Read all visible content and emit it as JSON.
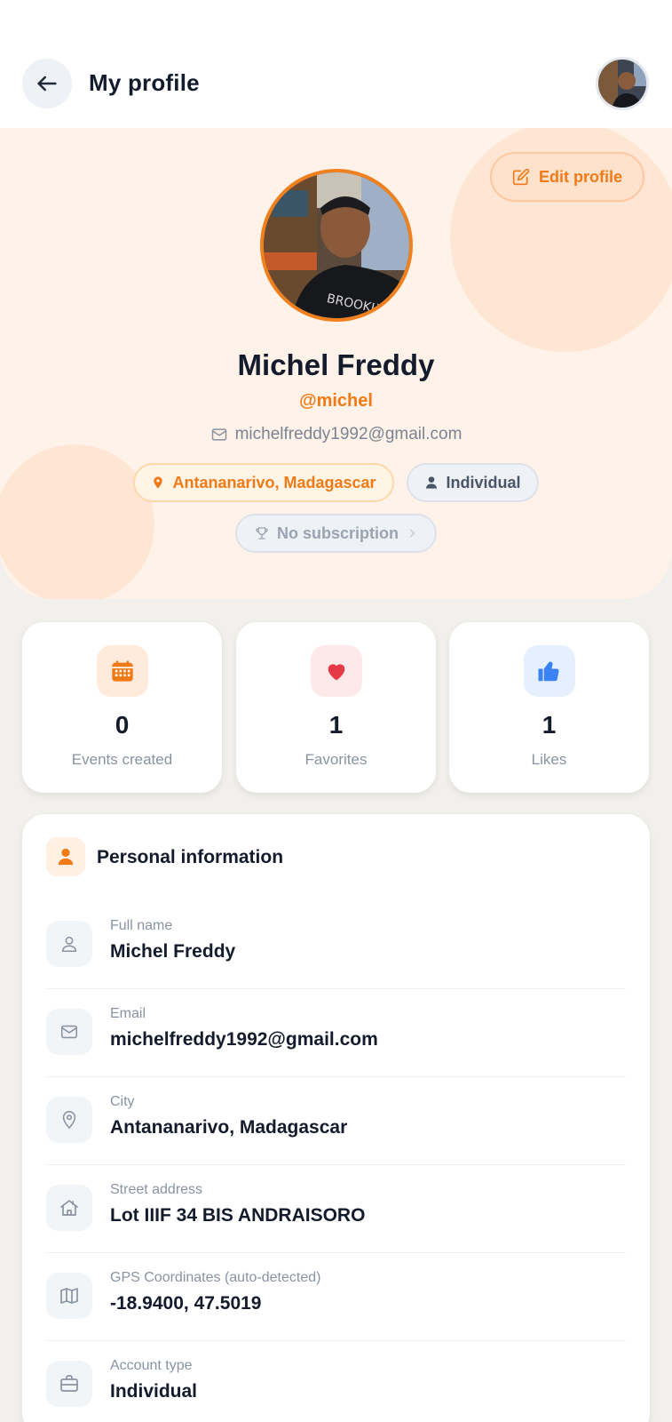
{
  "header": {
    "title": "My profile"
  },
  "profile": {
    "edit_label": "Edit profile",
    "name": "Michel Freddy",
    "handle": "@michel",
    "email": "michelfreddy1992@gmail.com",
    "city_chip": "Antananarivo, Madagascar",
    "type_chip": "Individual",
    "subscription_chip": "No subscription"
  },
  "stats": [
    {
      "value": "0",
      "label": "Events created",
      "icon": "calendar-icon"
    },
    {
      "value": "1",
      "label": "Favorites",
      "icon": "heart-icon"
    },
    {
      "value": "1",
      "label": "Likes",
      "icon": "thumbs-up-icon"
    }
  ],
  "personal_info": {
    "title": "Personal information",
    "rows": [
      {
        "label": "Full name",
        "value": "Michel Freddy",
        "icon": "user-icon"
      },
      {
        "label": "Email",
        "value": "michelfreddy1992@gmail.com",
        "icon": "mail-icon"
      },
      {
        "label": "City",
        "value": "Antananarivo, Madagascar",
        "icon": "map-pin-icon"
      },
      {
        "label": "Street address",
        "value": "Lot IIIF 34 BIS ANDRAISORO",
        "icon": "home-icon"
      },
      {
        "label": "GPS Coordinates (auto-detected)",
        "value": "-18.9400, 47.5019",
        "icon": "map-icon"
      },
      {
        "label": "Account type",
        "value": "Individual",
        "icon": "briefcase-icon"
      }
    ]
  },
  "colors": {
    "accent": "#ef7a16",
    "hero_bg": "#fff2e8",
    "page_bg": "#f2f0ec",
    "heart": "#e63946",
    "like": "#3b82f6"
  }
}
